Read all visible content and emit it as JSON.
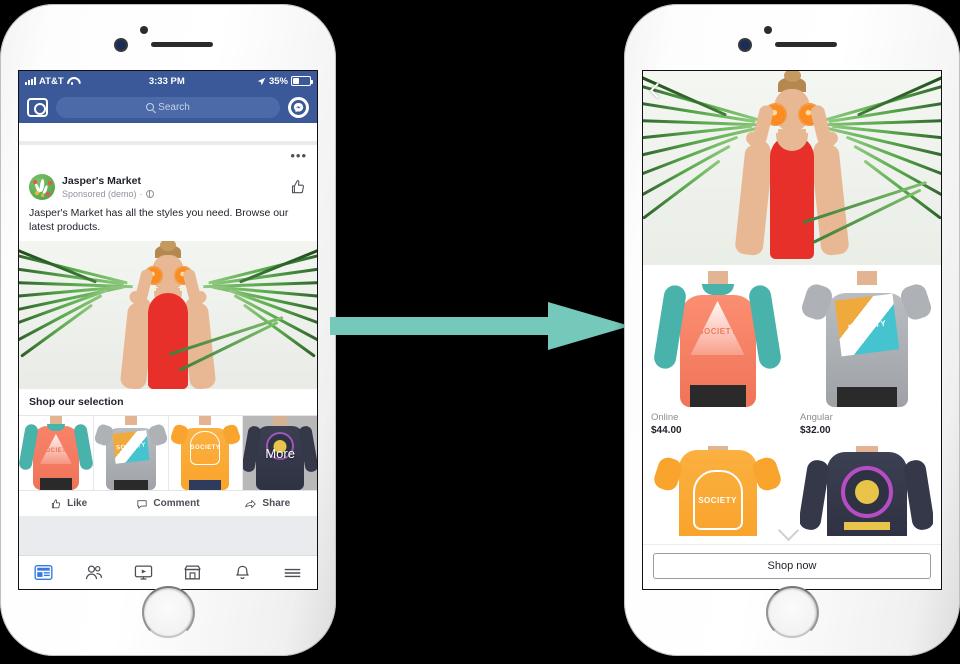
{
  "left_phone": {
    "status_bar": {
      "carrier": "AT&T",
      "time": "3:33 PM",
      "battery": "35%",
      "signal_icon": "signal-bars-icon",
      "wifi_icon": "wifi-icon",
      "location_icon": "location-arrow-icon",
      "battery_icon": "battery-icon"
    },
    "nav": {
      "camera_icon": "camera-icon",
      "search_placeholder": "Search",
      "search_icon": "search-icon",
      "messenger_icon": "messenger-icon"
    },
    "post": {
      "menu_icon": "more-options-icon",
      "page_name": "Jasper's Market",
      "sponsored_label": "Sponsored (demo)",
      "privacy_separator": "·",
      "privacy_icon": "globe-icon",
      "like_page_icon": "thumbs-up-outline-icon",
      "body_text": "Jasper's Market has all the styles you need. Browse our latest products.",
      "hero_alt": "woman-with-oranges-photo",
      "collection_title": "Shop our selection",
      "thumbnails": [
        {
          "name": "coral-teal-raglan-thumbnail",
          "overlay": ""
        },
        {
          "name": "grey-graphic-tee-thumbnail",
          "overlay": ""
        },
        {
          "name": "orange-graphic-tee-thumbnail",
          "overlay": ""
        },
        {
          "name": "navy-longsleeve-thumbnail",
          "overlay": "More"
        }
      ]
    },
    "actions": [
      {
        "label": "Like",
        "icon": "thumbs-up-icon"
      },
      {
        "label": "Comment",
        "icon": "comment-bubble-icon"
      },
      {
        "label": "Share",
        "icon": "share-arrow-icon"
      }
    ],
    "tabbar": [
      {
        "name": "tab-news-feed",
        "icon": "news-feed-icon",
        "active": true
      },
      {
        "name": "tab-friends",
        "icon": "friends-icon",
        "active": false
      },
      {
        "name": "tab-watch",
        "icon": "watch-video-icon",
        "active": false
      },
      {
        "name": "tab-marketplace",
        "icon": "marketplace-store-icon",
        "active": false
      },
      {
        "name": "tab-notifications",
        "icon": "bell-icon",
        "active": false
      },
      {
        "name": "tab-menu",
        "icon": "hamburger-menu-icon",
        "active": false
      }
    ]
  },
  "right_phone": {
    "back_icon": "back-chevron-icon",
    "hero_alt": "woman-with-oranges-photo",
    "products": [
      {
        "name": "Online",
        "price": "$44.00",
        "image": "coral-teal-raglan-photo"
      },
      {
        "name": "Angular",
        "price": "$32.00",
        "image": "grey-graphic-tee-photo"
      },
      {
        "name": "",
        "price": "",
        "image": "orange-graphic-tee-photo"
      },
      {
        "name": "",
        "price": "",
        "image": "navy-longsleeve-photo"
      }
    ],
    "scroll_hint_icon": "chevron-down-icon",
    "cta_label": "Shop now"
  },
  "arrow": {
    "name": "transition-arrow",
    "color": "#74c9bb",
    "direction": "right"
  },
  "theme": {
    "facebook_blue": "#3b5998",
    "feed_grey": "#e9ebee",
    "text_dark": "#1d2129",
    "text_muted": "#90949c"
  }
}
